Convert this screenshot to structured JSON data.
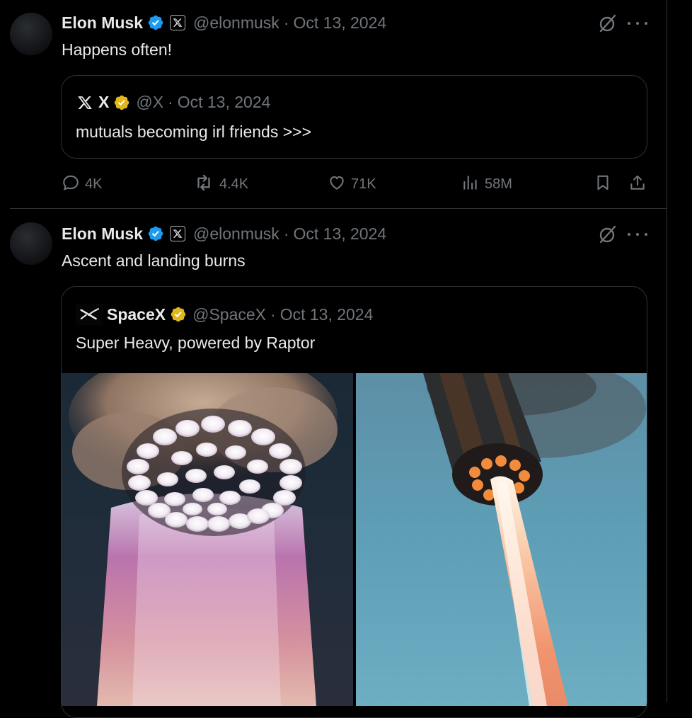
{
  "tweets": [
    {
      "author_name": "Elon Musk",
      "handle": "@elonmusk",
      "separator": "·",
      "date": "Oct 13, 2024",
      "text": "Happens often!",
      "quote": {
        "name": "X",
        "handle": "@X",
        "date": "Oct 13, 2024",
        "text": "mutuals becoming irl friends >>>"
      },
      "stats": {
        "replies": "4K",
        "reposts": "4.4K",
        "likes": "71K",
        "views": "58M"
      }
    },
    {
      "author_name": "Elon Musk",
      "handle": "@elonmusk",
      "separator": "·",
      "date": "Oct 13, 2024",
      "text": "Ascent and landing burns",
      "quote": {
        "name": "SpaceX",
        "handle": "@SpaceX",
        "date": "Oct 13, 2024",
        "text": "Super Heavy, powered by Raptor"
      }
    }
  ],
  "colors": {
    "verified_blue": "#1d9bf0",
    "verified_gold": "#e2b719",
    "muted": "#71767b",
    "text": "#e7e9ea",
    "border": "#2f3336"
  },
  "icons": [
    "verified-badge-icon",
    "x-logo-icon",
    "grok-icon",
    "more-icon",
    "reply-icon",
    "repost-icon",
    "like-icon",
    "views-icon",
    "bookmark-icon",
    "share-icon",
    "spacex-logo-icon"
  ]
}
